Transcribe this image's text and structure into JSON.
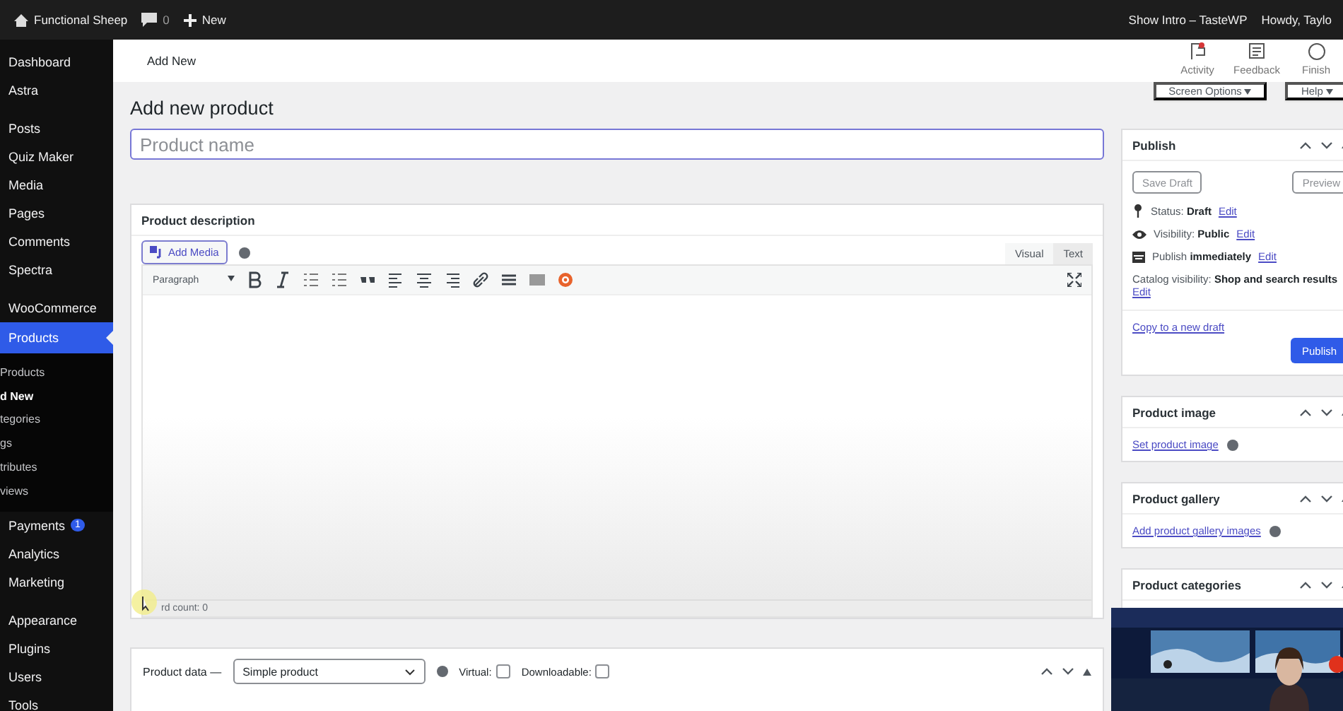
{
  "admin_bar": {
    "site": "Functional Sheep",
    "comments": "0",
    "new": "New",
    "right": [
      "Show Intro – TasteWP",
      "Howdy, Taylo"
    ]
  },
  "sidebar": {
    "groups": [
      [
        {
          "label": "Dashboard",
          "selected": false
        },
        {
          "label": "Astra",
          "selected": false
        }
      ],
      [
        {
          "label": "Posts",
          "selected": false
        },
        {
          "label": "Quiz Maker",
          "selected": false
        },
        {
          "label": "Media",
          "selected": false
        },
        {
          "label": "Pages",
          "selected": false
        },
        {
          "label": "Comments",
          "selected": false
        },
        {
          "label": "Spectra",
          "selected": false
        }
      ],
      [
        {
          "label": "WooCommerce",
          "selected": false
        },
        {
          "label": "Products",
          "selected": true,
          "children": [
            {
              "label": "Products",
              "selected": false
            },
            {
              "label": "d New",
              "selected": true
            },
            {
              "label": "tegories",
              "selected": false
            },
            {
              "label": "gs",
              "selected": false
            },
            {
              "label": "tributes",
              "selected": false
            },
            {
              "label": "views",
              "selected": false
            }
          ]
        },
        {
          "label": "Payments",
          "selected": false,
          "badge": "1"
        },
        {
          "label": "Analytics",
          "selected": false
        },
        {
          "label": "Marketing",
          "selected": false
        }
      ],
      [
        {
          "label": "Appearance",
          "selected": false
        },
        {
          "label": "Plugins",
          "selected": false
        },
        {
          "label": "Users",
          "selected": false
        },
        {
          "label": "Tools",
          "selected": false
        }
      ]
    ]
  },
  "header": {
    "title": "Add New",
    "actions": [
      {
        "label": "Activity",
        "kind": "flag"
      },
      {
        "label": "Feedback",
        "kind": "feedback"
      },
      {
        "label": "Finish",
        "kind": "circle"
      }
    ]
  },
  "screen_tabs": [
    "Screen Options",
    "Help"
  ],
  "page_title": "Add new product",
  "product_name": {
    "placeholder": "Product name"
  },
  "description": {
    "title": "Product description",
    "add_media": "Add Media",
    "tabs": [
      {
        "label": "Visual",
        "selected": true
      },
      {
        "label": "Text",
        "selected": false
      }
    ],
    "format": "Paragraph",
    "word_count": "rd count: 0"
  },
  "product_data": {
    "label": "Product data —",
    "type": "Simple product",
    "options": [
      {
        "label": "Virtual:",
        "checked": false
      },
      {
        "label": "Downloadable:",
        "checked": false
      }
    ]
  },
  "publish": {
    "title": "Publish",
    "save_draft": "Save Draft",
    "preview": "Preview",
    "rows": [
      {
        "kind": "pin",
        "text": "Status: **Draft**",
        "link": "Edit"
      },
      {
        "kind": "eye",
        "text": "Visibility: **Public**",
        "link": "Edit"
      },
      {
        "kind": "calendar",
        "text": "Publish **immediately**",
        "link": "Edit"
      }
    ],
    "catalog": "Catalog visibility: **Shop and search results**",
    "catalog_link": "Edit",
    "copy": "Copy to a new draft",
    "button": "Publish"
  },
  "side_boxes": [
    {
      "title": "Product image",
      "link": "Set product image"
    },
    {
      "title": "Product gallery",
      "link": "Add product gallery images"
    },
    {
      "title": "Product categories"
    }
  ],
  "webcam": {
    "kind": "picture"
  }
}
